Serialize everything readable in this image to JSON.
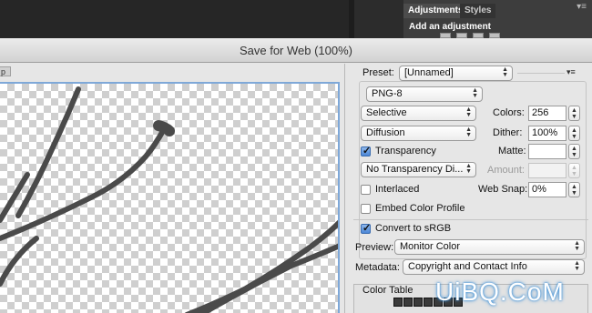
{
  "photoshop": {
    "adjustments_tab": "Adjustments",
    "styles_tab": "Styles",
    "add_adjustment": "Add an adjustment"
  },
  "dialog": {
    "title": "Save for Web (100%)",
    "view_tab_fragment": "p"
  },
  "settings": {
    "preset_label": "Preset:",
    "preset_value": "[Unnamed]",
    "format_value": "PNG-8",
    "reduction_value": "Selective",
    "colors_label": "Colors:",
    "colors_value": "256",
    "dither_algo_value": "Diffusion",
    "dither_label": "Dither:",
    "dither_value": "100%",
    "transparency_label": "Transparency",
    "transparency_checked": true,
    "matte_label": "Matte:",
    "matte_value": "",
    "transparency_dither_value": "No Transparency Di...",
    "amount_label": "Amount:",
    "amount_value": "",
    "interlaced_label": "Interlaced",
    "interlaced_checked": false,
    "web_snap_label": "Web Snap:",
    "web_snap_value": "0%",
    "embed_profile_label": "Embed Color Profile",
    "embed_profile_checked": false,
    "convert_srgb_label": "Convert to sRGB",
    "convert_srgb_checked": true,
    "preview_label": "Preview:",
    "preview_value": "Monitor Color",
    "metadata_label": "Metadata:",
    "metadata_value": "Copyright and Contact Info",
    "color_table_label": "Color Table"
  },
  "watermark": "UiBQ.CoM",
  "colors": {
    "canvas_border": "#7ea8d8",
    "checkbox_on": "#4a86d6",
    "stroke": "#4a4a4a"
  }
}
